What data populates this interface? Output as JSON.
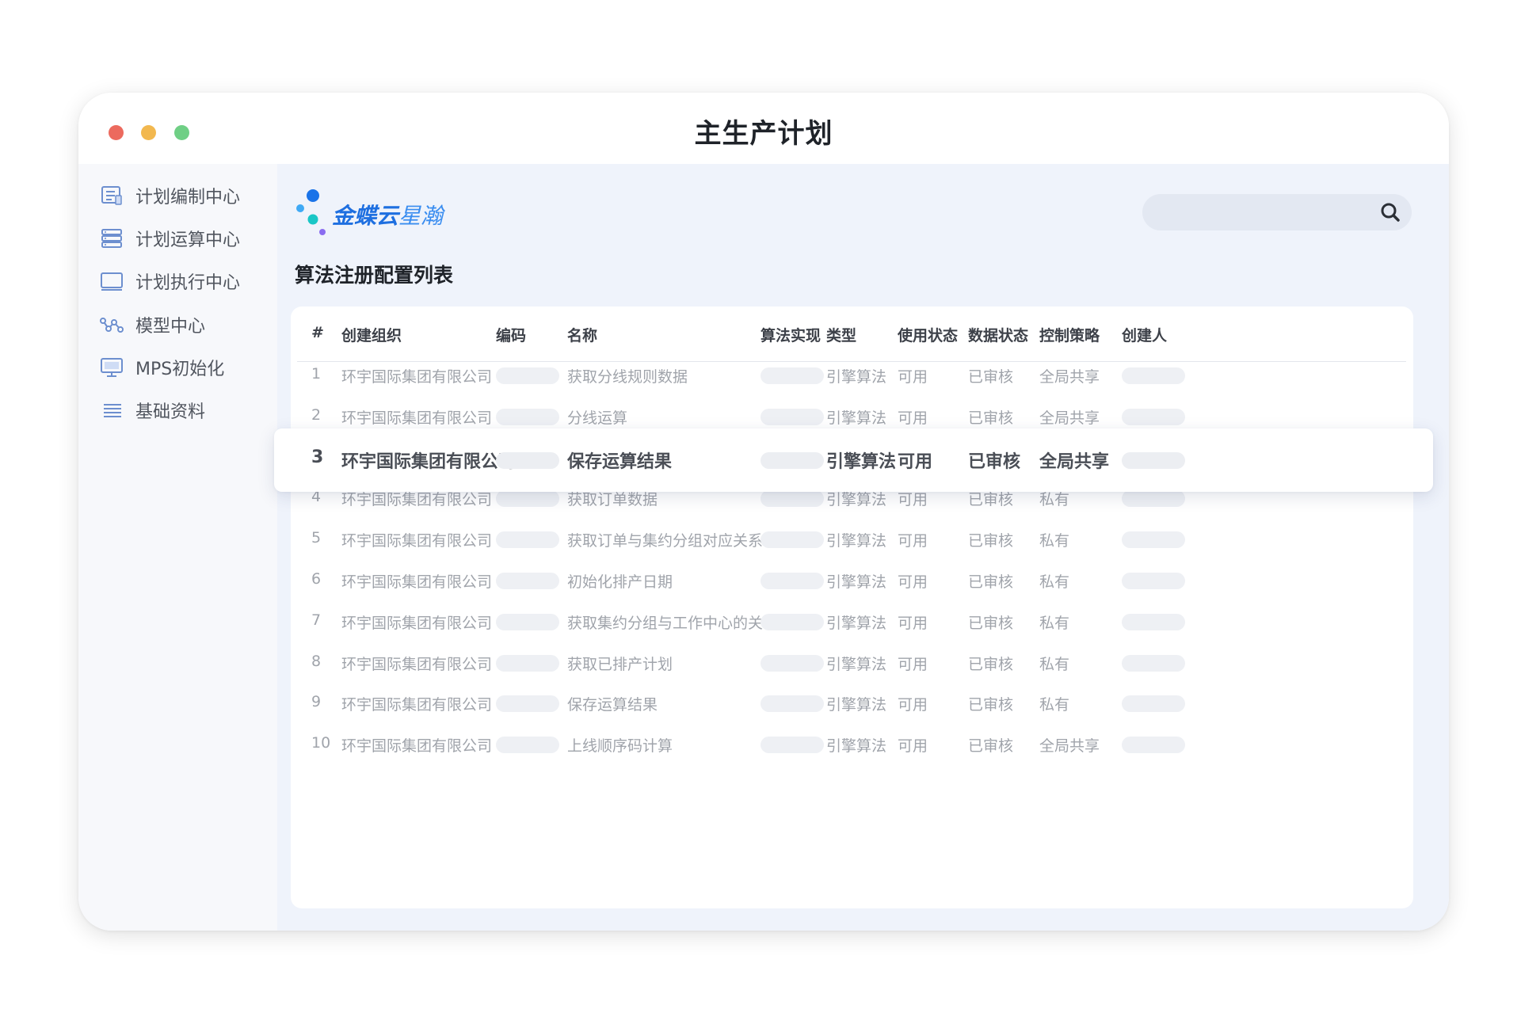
{
  "window": {
    "title": "主生产计划"
  },
  "sidebar": {
    "items": [
      {
        "label": "计划编制中心",
        "icon": "document-list-icon"
      },
      {
        "label": "计划运算中心",
        "icon": "server-stack-icon"
      },
      {
        "label": "计划执行中心",
        "icon": "monitor-icon"
      },
      {
        "label": "模型中心",
        "icon": "network-nodes-icon"
      },
      {
        "label": "MPS初始化",
        "icon": "desktop-icon"
      },
      {
        "label": "基础资料",
        "icon": "list-icon"
      }
    ]
  },
  "logo": {
    "text_bold": "金蝶云",
    "text_light": "星瀚"
  },
  "search": {
    "placeholder": "",
    "icon": "search-icon"
  },
  "page": {
    "heading": "算法注册配置列表"
  },
  "table": {
    "columns": [
      "#",
      "创建组织",
      "编码",
      "名称",
      "算法实现",
      "类型",
      "使用状态",
      "数据状态",
      "控制策略",
      "创建人"
    ],
    "rows": [
      {
        "no": "1",
        "org": "环宇国际集团有限公司",
        "name": "获取分线规则数据",
        "type": "引擎算法",
        "use_status": "可用",
        "data_status": "已审核",
        "policy": "全局共享"
      },
      {
        "no": "2",
        "org": "环宇国际集团有限公司",
        "name": "分线运算",
        "type": "引擎算法",
        "use_status": "可用",
        "data_status": "已审核",
        "policy": "全局共享"
      },
      {
        "no": "3",
        "org": "环宇国际集团有限公司",
        "name": "保存运算结果",
        "type": "引擎算法",
        "use_status": "可用",
        "data_status": "已审核",
        "policy": "全局共享"
      },
      {
        "no": "4",
        "org": "环宇国际集团有限公司",
        "name": "获取订单数据",
        "type": "引擎算法",
        "use_status": "可用",
        "data_status": "已审核",
        "policy": "私有"
      },
      {
        "no": "5",
        "org": "环宇国际集团有限公司",
        "name": "获取订单与集约分组对应关系",
        "type": "引擎算法",
        "use_status": "可用",
        "data_status": "已审核",
        "policy": "私有"
      },
      {
        "no": "6",
        "org": "环宇国际集团有限公司",
        "name": "初始化排产日期",
        "type": "引擎算法",
        "use_status": "可用",
        "data_status": "已审核",
        "policy": "私有"
      },
      {
        "no": "7",
        "org": "环宇国际集团有限公司",
        "name": "获取集约分组与工作中心的关系",
        "type": "引擎算法",
        "use_status": "可用",
        "data_status": "已审核",
        "policy": "私有"
      },
      {
        "no": "8",
        "org": "环宇国际集团有限公司",
        "name": "获取已排产计划",
        "type": "引擎算法",
        "use_status": "可用",
        "data_status": "已审核",
        "policy": "私有"
      },
      {
        "no": "9",
        "org": "环宇国际集团有限公司",
        "name": "保存运算结果",
        "type": "引擎算法",
        "use_status": "可用",
        "data_status": "已审核",
        "policy": "私有"
      },
      {
        "no": "10",
        "org": "环宇国际集团有限公司",
        "name": "上线顺序码计算",
        "type": "引擎算法",
        "use_status": "可用",
        "data_status": "已审核",
        "policy": "全局共享"
      }
    ]
  },
  "colors": {
    "accent": "#1e6fe0",
    "main_bg": "#eff3fb",
    "sidebar_bg": "#f7f8fb",
    "muted_text": "#a0a4ab"
  }
}
